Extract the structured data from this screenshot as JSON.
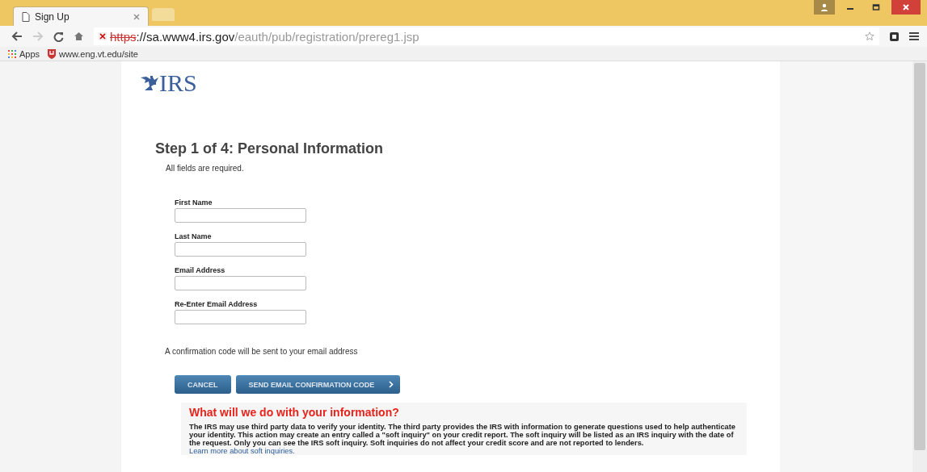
{
  "browser": {
    "tabs": [
      {
        "title": "Sign Up",
        "selected": true
      },
      {
        "selected": false
      }
    ],
    "address": {
      "secure": false,
      "scheme": "https",
      "host": "://sa.www4.irs.gov",
      "path": "/eauth/pub/registration/prereg1.jsp"
    },
    "bookmarks": [
      {
        "label": "Apps",
        "kind": "apps"
      },
      {
        "label": "www.eng.vt.edu/site",
        "kind": "site"
      }
    ]
  },
  "page": {
    "logo": "IRS",
    "heading": "Step 1 of 4:  Personal Information",
    "note": "All fields are required.",
    "fields": [
      {
        "label": "First Name"
      },
      {
        "label": "Last Name"
      },
      {
        "label": "Email Address"
      },
      {
        "label": "Re-Enter Email Address"
      }
    ],
    "confirmation": "A confirmation code will be sent to your email address",
    "buttons": [
      {
        "label": "CANCEL",
        "kind": "secondary"
      },
      {
        "label": "SEND EMAIL CONFIRMATION CODE",
        "kind": "primary"
      }
    ],
    "info": {
      "title": "What will we do with your information?",
      "text": "The IRS may use third party data to verify your identity. The third party provides the IRS with information to generate questions used to help authenticate your identity. This action may create an entry called a \"soft inquiry\" on your credit report. The soft inquiry will be listed as an IRS inquiry with the date of the request. Only you can see the IRS soft inquiry. Soft inquiries do not affect your credit score and are not reported to lenders.",
      "link": "Learn more about soft inquiries."
    }
  }
}
